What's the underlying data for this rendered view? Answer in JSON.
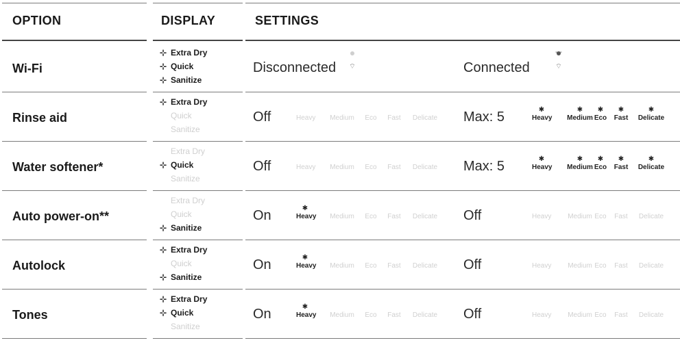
{
  "headers": {
    "option": "OPTION",
    "display": "DISPLAY",
    "settings": "SETTINGS"
  },
  "modes": [
    "Heavy",
    "Medium",
    "Eco",
    "Fast",
    "Delicate"
  ],
  "rows": [
    {
      "option": "Wi-Fi",
      "display": [
        {
          "label": "Extra Dry",
          "lit": true
        },
        {
          "label": "Quick",
          "lit": true
        },
        {
          "label": "Sanitize",
          "lit": true
        }
      ],
      "left": {
        "value": "Disconnected",
        "icon": "wifi-disconnected-icon"
      },
      "right": {
        "value": "Connected",
        "icon": "wifi-connected-icon"
      }
    },
    {
      "option": "Rinse aid",
      "display": [
        {
          "label": "Extra Dry",
          "lit": true
        },
        {
          "label": "Quick",
          "lit": false
        },
        {
          "label": "Sanitize",
          "lit": false
        }
      ],
      "left": {
        "value": "Off",
        "lit_modes": []
      },
      "right": {
        "value": "Max: 5",
        "lit_modes": [
          0,
          1,
          2,
          3,
          4
        ]
      }
    },
    {
      "option": "Water softener*",
      "display": [
        {
          "label": "Extra Dry",
          "lit": false
        },
        {
          "label": "Quick",
          "lit": true
        },
        {
          "label": "Sanitize",
          "lit": false
        }
      ],
      "left": {
        "value": "Off",
        "lit_modes": []
      },
      "right": {
        "value": "Max: 5",
        "lit_modes": [
          0,
          1,
          2,
          3,
          4
        ]
      }
    },
    {
      "option": "Auto power-on**",
      "display": [
        {
          "label": "Extra Dry",
          "lit": false
        },
        {
          "label": "Quick",
          "lit": false
        },
        {
          "label": "Sanitize",
          "lit": true
        }
      ],
      "left": {
        "value": "On",
        "lit_modes": [
          0
        ]
      },
      "right": {
        "value": "Off",
        "lit_modes": []
      }
    },
    {
      "option": "Autolock",
      "display": [
        {
          "label": "Extra Dry",
          "lit": true
        },
        {
          "label": "Quick",
          "lit": false
        },
        {
          "label": "Sanitize",
          "lit": true
        }
      ],
      "left": {
        "value": "On",
        "lit_modes": [
          0
        ]
      },
      "right": {
        "value": "Off",
        "lit_modes": []
      }
    },
    {
      "option": "Tones",
      "display": [
        {
          "label": "Extra Dry",
          "lit": true
        },
        {
          "label": "Quick",
          "lit": true
        },
        {
          "label": "Sanitize",
          "lit": false
        }
      ],
      "left": {
        "value": "On",
        "lit_modes": [
          0
        ]
      },
      "right": {
        "value": "Off",
        "lit_modes": []
      }
    }
  ]
}
